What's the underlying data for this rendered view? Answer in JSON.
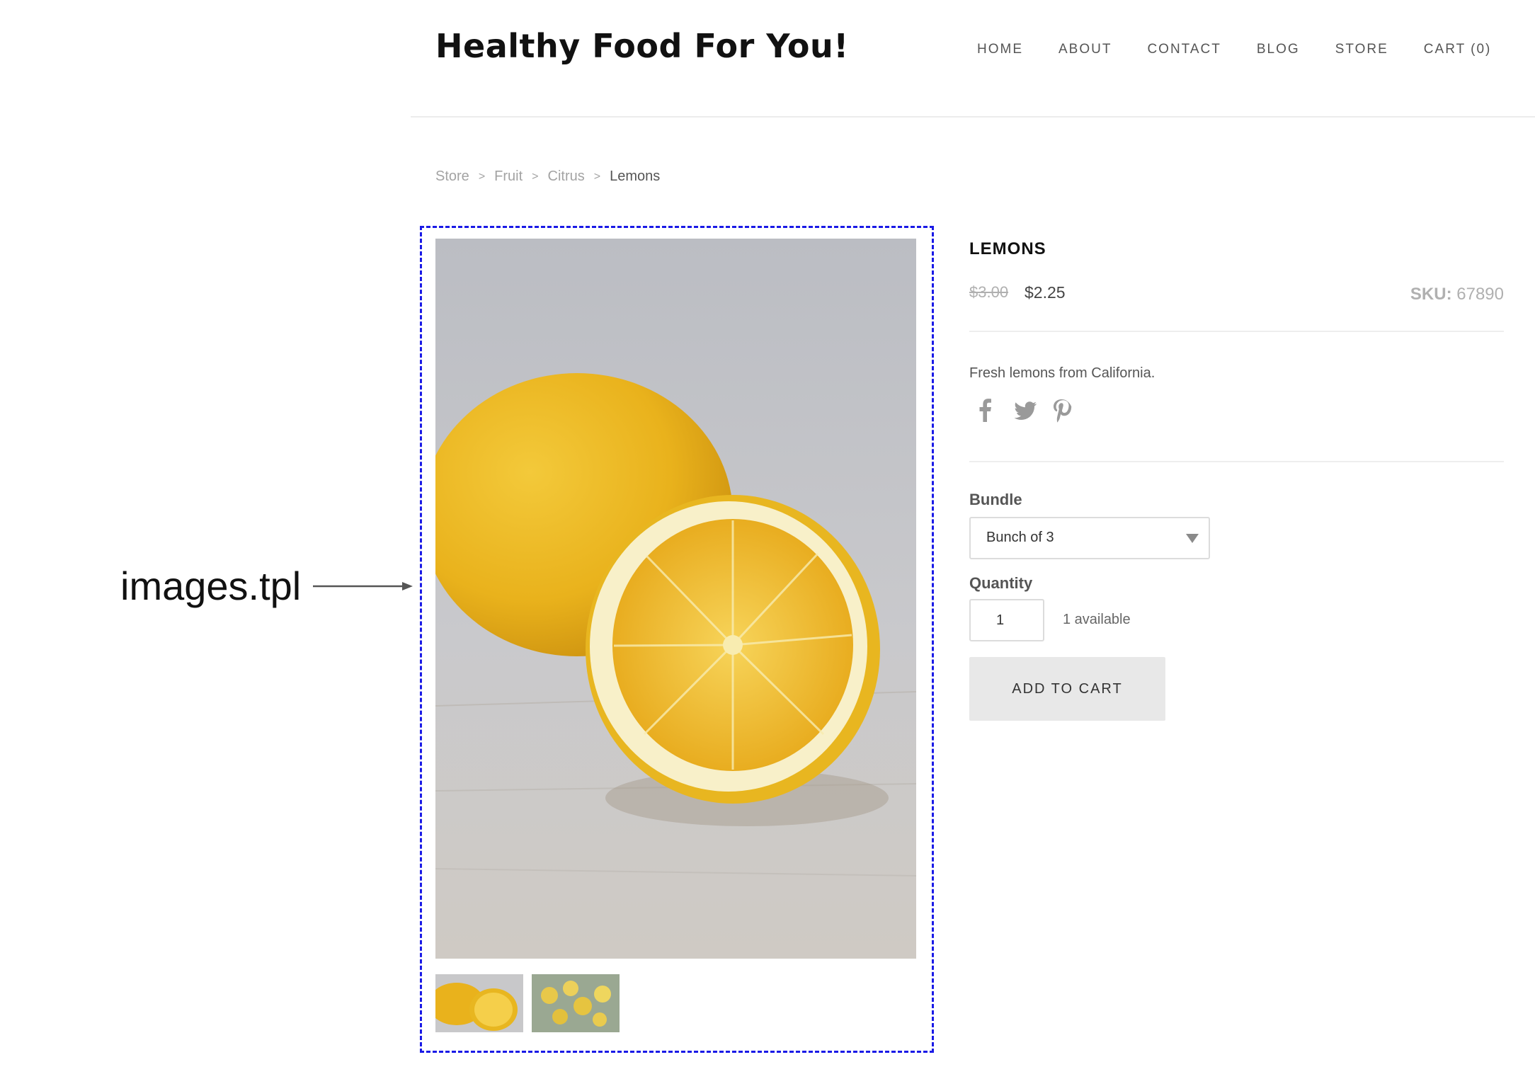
{
  "header": {
    "site_title": "Healthy Food For You!",
    "nav": [
      {
        "label": "HOME"
      },
      {
        "label": "ABOUT"
      },
      {
        "label": "CONTACT"
      },
      {
        "label": "BLOG"
      },
      {
        "label": "STORE"
      },
      {
        "label": "CART (0)"
      }
    ]
  },
  "breadcrumb": {
    "items": [
      "Store",
      "Fruit",
      "Citrus"
    ],
    "separator": ">",
    "current": "Lemons"
  },
  "annotation": {
    "label": "images.tpl",
    "box_color": "#1a1ae6"
  },
  "gallery": {
    "main_image": "lemon-halves-photo",
    "thumbnails": [
      "lemon-halves-thumb",
      "lemon-tree-thumb"
    ]
  },
  "product": {
    "title": "LEMONS",
    "price_old": "$3.00",
    "price_new": "$2.25",
    "sku_label": "SKU:",
    "sku_value": "67890",
    "description": "Fresh lemons from California.",
    "social_icons": [
      "facebook-icon",
      "twitter-icon",
      "pinterest-icon"
    ],
    "bundle": {
      "label": "Bundle",
      "selected": "Bunch of 3"
    },
    "quantity": {
      "label": "Quantity",
      "value": "1",
      "availability": "1 available"
    },
    "add_to_cart_label": "ADD TO CART"
  }
}
